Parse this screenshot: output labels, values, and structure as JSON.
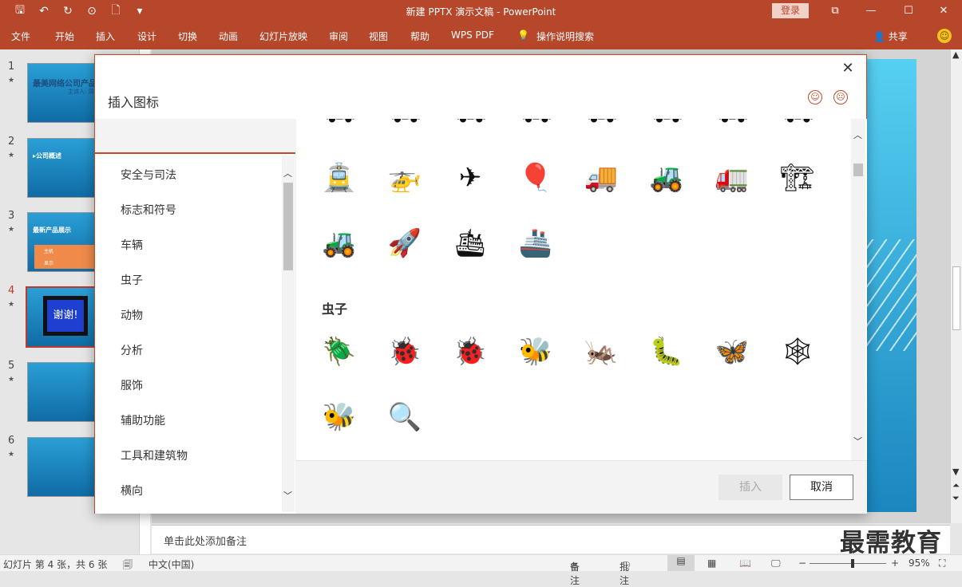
{
  "window": {
    "title": "新建 PPTX 演示文稿 - PowerPoint",
    "login_label": "登录",
    "controls": [
      "⧉",
      "—",
      "☐",
      "✕"
    ]
  },
  "qat": {
    "save": "🖫",
    "undo": "↶",
    "redo": "↻",
    "present": "⊙",
    "new": "🗋",
    "more": "▾"
  },
  "ribbon": {
    "tabs": [
      "文件",
      "开始",
      "插入",
      "设计",
      "切换",
      "动画",
      "幻灯片放映",
      "审阅",
      "视图",
      "帮助",
      "WPS PDF",
      "操作说明搜索"
    ],
    "share_label": "共享"
  },
  "slides": [
    {
      "number": "1",
      "title": "最美网络公司产品",
      "subtitle": "主讲人: 周××"
    },
    {
      "number": "2",
      "title": "▸公司概述"
    },
    {
      "number": "3",
      "title": "最新产品展示",
      "labels": [
        "主机",
        "显示"
      ]
    },
    {
      "number": "4",
      "title": "谢谢!"
    },
    {
      "number": "5"
    },
    {
      "number": "6"
    }
  ],
  "notes_placeholder": "单击此处添加备注",
  "watermark": "最需教育",
  "status": {
    "slide_info": "幻灯片 第 4 张，共 6 张",
    "language": "中文(中国)",
    "notes_label": "备注",
    "comments_label": "批注",
    "zoom": "95%",
    "zoom_fraction": 0.57
  },
  "dialog": {
    "title": "插入图标",
    "categories": [
      "安全与司法",
      "标志和符号",
      "车辆",
      "虫子",
      "动物",
      "分析",
      "服饰",
      "辅助功能",
      "工具和建筑物",
      "横向"
    ],
    "section_label": "虫子",
    "vehicle_icons_top": [
      "⛟",
      "⛟",
      "⛟",
      "⛟",
      "⛟",
      "⛟",
      "⛟",
      "⛟"
    ],
    "vehicle_icons_row1": [
      {
        "name": "tram-icon",
        "glyph": "🚊"
      },
      {
        "name": "helicopter-icon",
        "glyph": "🚁"
      },
      {
        "name": "airplane-icon",
        "glyph": "✈"
      },
      {
        "name": "hot-air-balloon-icon",
        "glyph": "🎈"
      },
      {
        "name": "dump-truck-icon",
        "glyph": "🚚"
      },
      {
        "name": "bulldozer-icon",
        "glyph": "🚜"
      },
      {
        "name": "concrete-mixer-icon",
        "glyph": "🚛"
      },
      {
        "name": "excavator-icon",
        "glyph": "🏗"
      }
    ],
    "vehicle_icons_row2": [
      {
        "name": "tractor-icon",
        "glyph": "🚜"
      },
      {
        "name": "rocket-icon",
        "glyph": "🚀"
      },
      {
        "name": "cruise-ship-icon",
        "glyph": "🛳"
      },
      {
        "name": "steamship-icon",
        "glyph": "🚢"
      }
    ],
    "bug_icons_row1": [
      {
        "name": "beetle-icon",
        "glyph": "🪲"
      },
      {
        "name": "bug-icon",
        "glyph": "🐞"
      },
      {
        "name": "ladybug-icon",
        "glyph": "🐞"
      },
      {
        "name": "bee-icon",
        "glyph": "🐝"
      },
      {
        "name": "grasshopper-icon",
        "glyph": "🦗"
      },
      {
        "name": "caterpillar-icon",
        "glyph": "🐛"
      },
      {
        "name": "butterfly-icon",
        "glyph": "🦋"
      },
      {
        "name": "spider-web-icon",
        "glyph": "🕸"
      }
    ],
    "bug_icons_row2": [
      {
        "name": "beehive-icon",
        "glyph": "🐝"
      },
      {
        "name": "bug-search-icon",
        "glyph": "🔍"
      }
    ],
    "insert_label": "插入",
    "cancel_label": "取消"
  }
}
